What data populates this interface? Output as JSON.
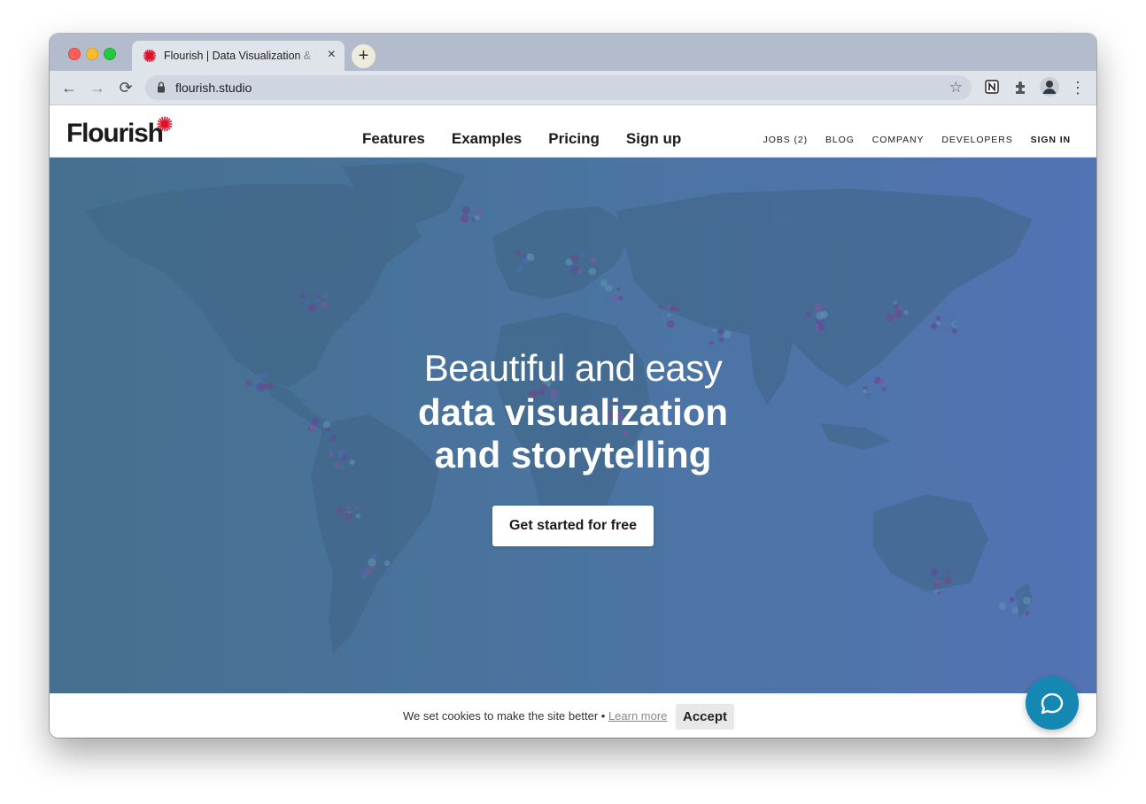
{
  "browser": {
    "tab_title": "Flourish | Data Visualization & Storytelling",
    "tab_close": "×",
    "new_tab": "+",
    "url": "flourish.studio",
    "back": "←",
    "forward": "→",
    "reload": "⟳",
    "bookmark": "☆",
    "menu": "⋮"
  },
  "site": {
    "logo": "Flourish",
    "nav": [
      "Features",
      "Examples",
      "Pricing",
      "Sign up"
    ],
    "subnav": [
      "JOBS (2)",
      "BLOG",
      "COMPANY",
      "DEVELOPERS",
      "SIGN IN"
    ]
  },
  "hero": {
    "line1": "Beautiful and easy",
    "line2": "data visualization",
    "line3": "and storytelling",
    "cta": "Get started for free"
  },
  "cookie": {
    "text": "We set cookies to make the site better •",
    "link": "Learn more",
    "accept": "Accept"
  },
  "colors": {
    "brand_red": "#e0102a",
    "hero_left": "#45708f",
    "hero_right": "#5373b4",
    "chat_button": "#1487b3"
  }
}
